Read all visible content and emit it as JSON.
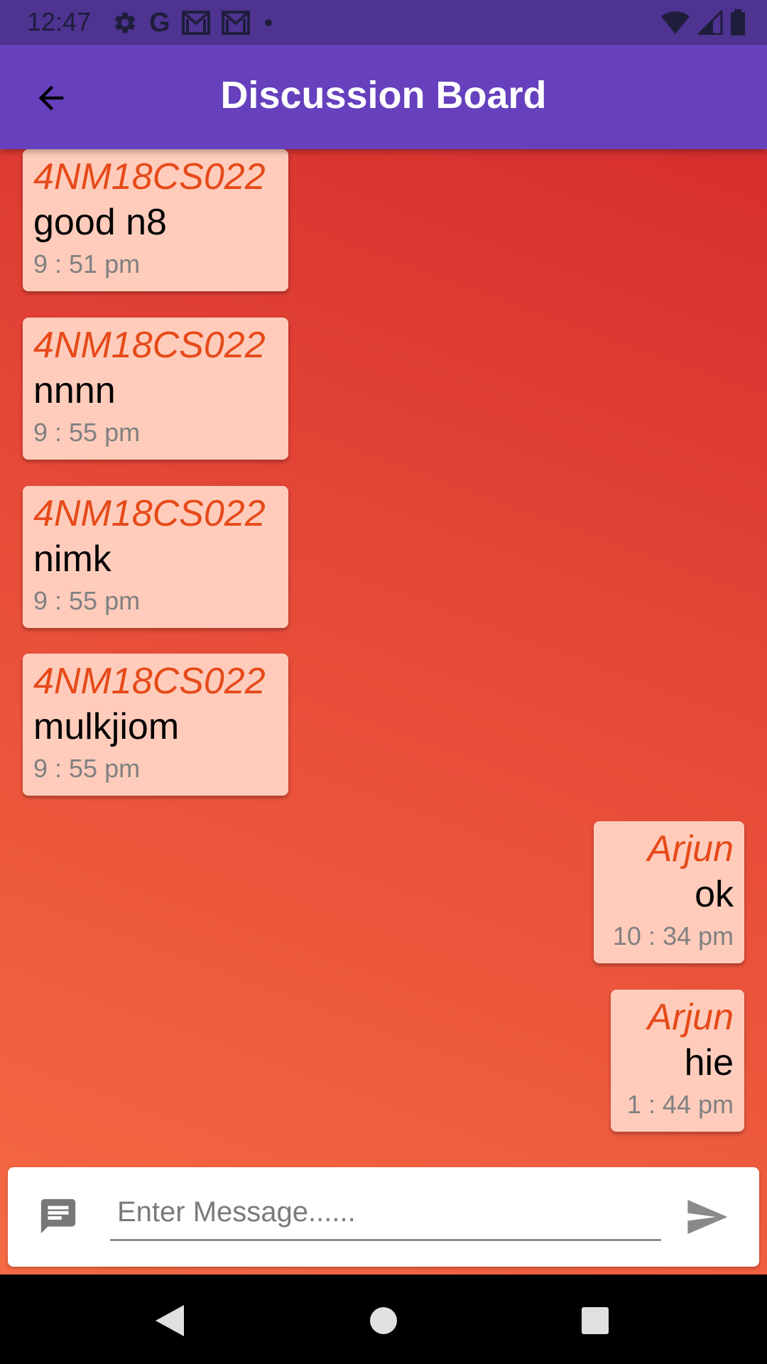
{
  "status_bar": {
    "time": "12:47",
    "left_icons": [
      "settings-icon",
      "google-icon",
      "gmail-icon",
      "gmail-icon",
      "dot-icon"
    ],
    "right_icons": [
      "wifi-icon",
      "cell-signal-icon",
      "battery-icon"
    ],
    "google_letter": "G"
  },
  "app_bar": {
    "title": "Discussion Board",
    "back_icon": "arrow-back-icon",
    "color": "#6640bd"
  },
  "messages": [
    {
      "sender": "4NM18CS022",
      "text": "good n8",
      "time": "9 : 51 pm",
      "align": "left"
    },
    {
      "sender": "4NM18CS022",
      "text": "nnnn",
      "time": "9 : 55 pm",
      "align": "left"
    },
    {
      "sender": "4NM18CS022",
      "text": "nimk",
      "time": "9 : 55 pm",
      "align": "left"
    },
    {
      "sender": "4NM18CS022",
      "text": "mulkjiom",
      "time": "9 : 55 pm",
      "align": "left"
    },
    {
      "sender": "Arjun",
      "text": "ok",
      "time": "10 : 34 pm",
      "align": "right"
    },
    {
      "sender": "Arjun",
      "text": "hie",
      "time": "1 : 44 pm",
      "align": "right"
    }
  ],
  "composer": {
    "placeholder": "Enter Message......",
    "value": "",
    "message_icon": "message-icon",
    "send_icon": "send-icon"
  },
  "nav_bar": {
    "buttons": [
      "back-triangle-icon",
      "home-circle-icon",
      "recents-square-icon"
    ]
  },
  "colors": {
    "bubble_bg": "#ffccbc",
    "sender_color": "#e64a19",
    "time_color": "#808080",
    "gradient_top": "#d62e2e",
    "gradient_bottom": "#f56a43"
  }
}
